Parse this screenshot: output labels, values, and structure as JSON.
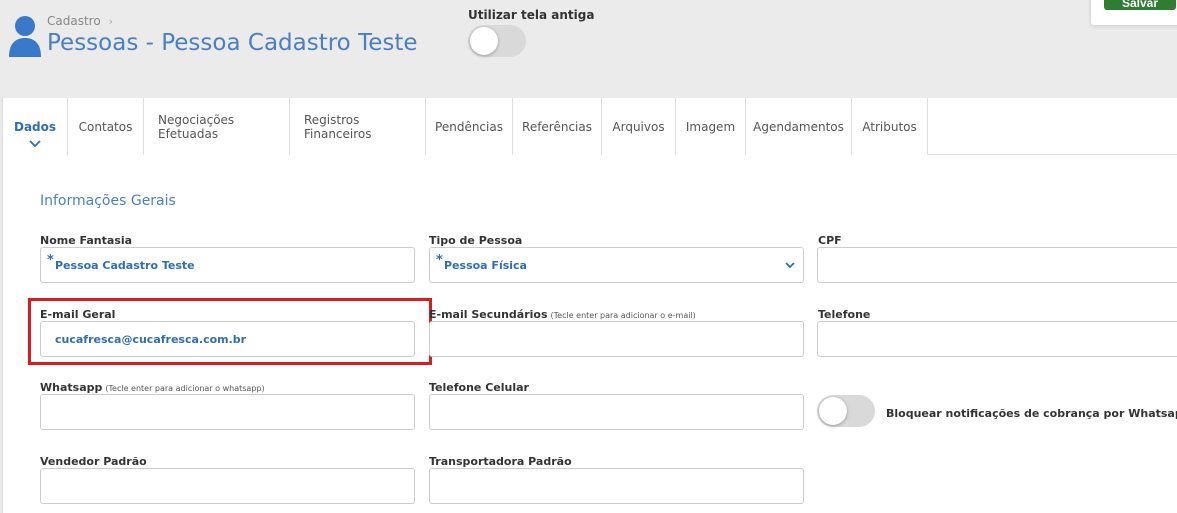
{
  "header": {
    "breadcrumb": "Cadastro",
    "title": "Pessoas - Pessoa Cadastro Teste",
    "old_screen_label": "Utilizar tela antiga",
    "save_label": "Salvar"
  },
  "tabs": [
    {
      "label": "Dados",
      "active": true
    },
    {
      "label": "Contatos"
    },
    {
      "label": "Negociações Efetuadas"
    },
    {
      "label": "Registros Financeiros"
    },
    {
      "label": "Pendências"
    },
    {
      "label": "Referências"
    },
    {
      "label": "Arquivos"
    },
    {
      "label": "Imagem"
    },
    {
      "label": "Agendamentos"
    },
    {
      "label": "Atributos"
    }
  ],
  "form": {
    "section_title": "Informações Gerais",
    "nome_fantasia": {
      "label": "Nome Fantasia",
      "value": "Pessoa Cadastro Teste",
      "required_mark": "*"
    },
    "tipo_pessoa": {
      "label": "Tipo de Pessoa",
      "value": "Pessoa Física",
      "required_mark": "*"
    },
    "cpf": {
      "label": "CPF",
      "value": ""
    },
    "email_geral": {
      "label": "E-mail Geral",
      "value": "cucafresca@cucafresca.com.br"
    },
    "email_secundarios": {
      "label": "E-mail Secundários",
      "hint": "(Tecle enter para adicionar o e-mail)",
      "value": ""
    },
    "telefone": {
      "label": "Telefone",
      "value": ""
    },
    "whatsapp": {
      "label": "Whatsapp",
      "hint": "(Tecle enter para adicionar o whatsapp)",
      "value": ""
    },
    "telefone_celular": {
      "label": "Telefone Celular",
      "value": ""
    },
    "bloquear_notificacoes": {
      "label": "Bloquear notificações de cobrança por Whatsapp",
      "on": false
    },
    "vendedor_padrao": {
      "label": "Vendedor Padrão",
      "value": ""
    },
    "transportadora_padrao": {
      "label": "Transportadora Padrão",
      "value": ""
    }
  },
  "colors": {
    "accent": "#4a7fc1",
    "highlight": "#e01a1a",
    "save": "#2e7d32"
  }
}
